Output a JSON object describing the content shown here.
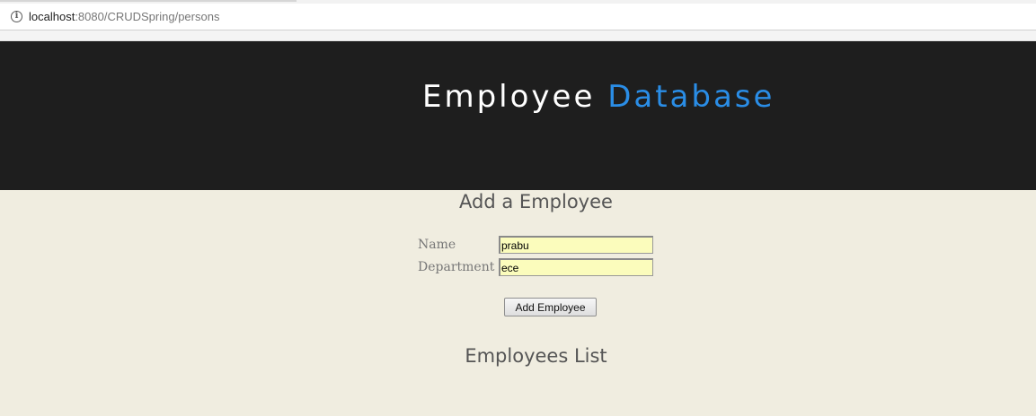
{
  "browser": {
    "url_host": "localhost",
    "url_path": ":8080/CRUDSpring/persons",
    "info_icon": "info-icon"
  },
  "header": {
    "title_main": "Employee",
    "title_accent": "Database"
  },
  "form": {
    "heading": "Add a Employee",
    "name_label": "Name",
    "name_value": "prabu",
    "department_label": "Department",
    "department_value": "ece",
    "submit_label": "Add Employee"
  },
  "list": {
    "heading": "Employees List"
  },
  "colors": {
    "header_bg": "#1e1e1e",
    "accent": "#2a8de6",
    "page_bg": "#f0ede0",
    "input_bg": "#fbfcbc"
  }
}
